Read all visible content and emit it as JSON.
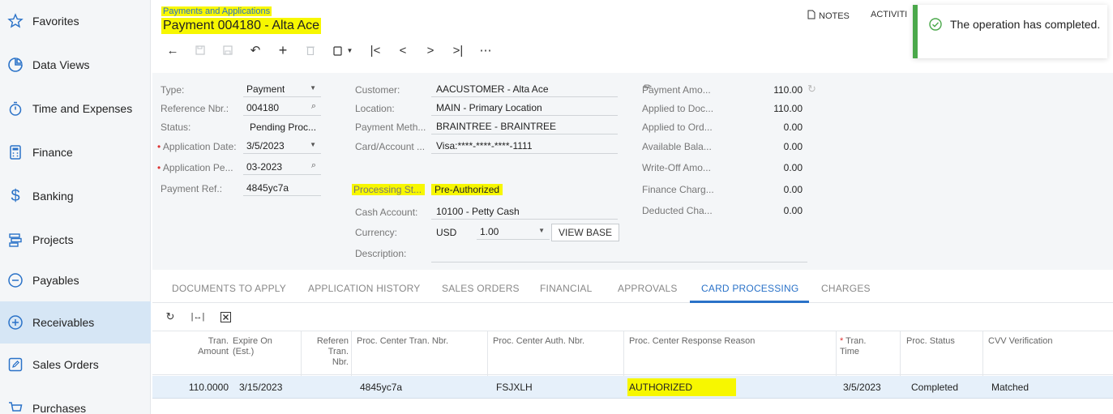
{
  "sidebar": {
    "items": [
      {
        "label": "Favorites",
        "icon": "star-icon"
      },
      {
        "label": "Data Views",
        "icon": "data-views-icon"
      },
      {
        "label": "Time and Expenses",
        "icon": "stopwatch-icon"
      },
      {
        "label": "Finance",
        "icon": "calculator-icon"
      },
      {
        "label": "Banking",
        "icon": "dollar-icon"
      },
      {
        "label": "Projects",
        "icon": "projects-icon"
      },
      {
        "label": "Payables",
        "icon": "minus-circle-icon"
      },
      {
        "label": "Receivables",
        "icon": "plus-circle-icon"
      },
      {
        "label": "Sales Orders",
        "icon": "pencil-square-icon"
      },
      {
        "label": "Purchases",
        "icon": "cart-icon"
      }
    ],
    "active": "Receivables"
  },
  "header": {
    "breadcrumb": "Payments and Applications",
    "title": "Payment 004180 - Alta Ace",
    "notes": "NOTES",
    "activities": "ACTIVITI"
  },
  "toast": {
    "message": "The operation has completed."
  },
  "form": {
    "type_label": "Type:",
    "type_value": "Payment",
    "ref_label": "Reference Nbr.:",
    "ref_value": "004180",
    "status_label": "Status:",
    "status_value": "Pending Proc...",
    "app_date_label": "Application Date:",
    "app_date_value": "3/5/2023",
    "app_period_label": "Application Pe...",
    "app_period_value": "03-2023",
    "pay_ref_label": "Payment Ref.:",
    "pay_ref_value": "4845yc7a",
    "customer_label": "Customer:",
    "customer_value": "AACUSTOMER - Alta Ace",
    "location_label": "Location:",
    "location_value": "MAIN - Primary Location",
    "pay_method_label": "Payment Meth...",
    "pay_method_value": "BRAINTREE - BRAINTREE",
    "card_label": "Card/Account ...",
    "card_value": "Visa:****-****-****-1111",
    "proc_status_label": "Processing St...",
    "proc_status_value": "Pre-Authorized",
    "cash_acct_label": "Cash Account:",
    "cash_acct_value": "10100 - Petty Cash",
    "currency_label": "Currency:",
    "currency_value": "USD",
    "rate_value": "1.00",
    "view_base": "VIEW BASE",
    "description_label": "Description:",
    "amounts": [
      {
        "label": "Payment Amo...",
        "value": "110.00"
      },
      {
        "label": "Applied to Doc...",
        "value": "110.00"
      },
      {
        "label": "Applied to Ord...",
        "value": "0.00"
      },
      {
        "label": "Available Bala...",
        "value": "0.00"
      },
      {
        "label": "Write-Off Amo...",
        "value": "0.00"
      },
      {
        "label": "Finance Charg...",
        "value": "0.00"
      },
      {
        "label": "Deducted Cha...",
        "value": "0.00"
      }
    ]
  },
  "tabs": [
    "DOCUMENTS TO APPLY",
    "APPLICATION HISTORY",
    "SALES ORDERS",
    "FINANCIAL",
    "APPROVALS",
    "CARD PROCESSING",
    "CHARGES"
  ],
  "active_tab": "CARD PROCESSING",
  "grid": {
    "headers": {
      "tran_amount_1": "Tran.",
      "tran_amount_2": "Amount",
      "expire_1": "Expire On",
      "expire_2": "(Est.)",
      "ref_1": "Referen",
      "ref_2": "Tran.",
      "ref_3": "Nbr.",
      "proc_center_tran": "Proc. Center Tran. Nbr.",
      "proc_center_auth": "Proc. Center Auth. Nbr.",
      "proc_center_resp": "Proc. Center Response Reason",
      "tran_time_1": "Tran.",
      "tran_time_2": "Time",
      "proc_status": "Proc. Status",
      "cvv": "CVV Verification"
    },
    "row": {
      "amount": "110.0000",
      "expire": "3/15/2023",
      "proc_tran": "4845yc7a",
      "proc_auth": "FSJXLH",
      "response": "AUTHORIZED",
      "tran_time": "3/5/2023",
      "status": "Completed",
      "cvv": "Matched"
    }
  },
  "colors": {
    "highlight": "#f7f700",
    "accent": "#2a72c8",
    "success": "#4aa84a",
    "sidebar_active": "#d6e6f5"
  }
}
